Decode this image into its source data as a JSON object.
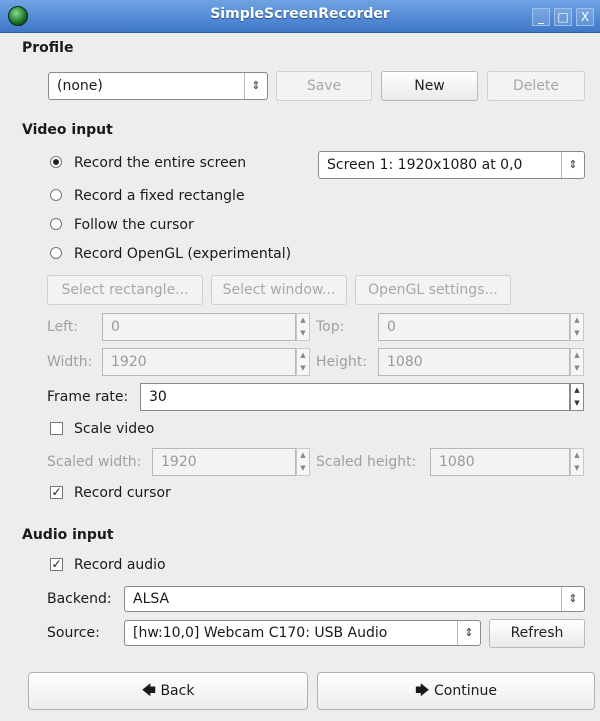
{
  "window": {
    "title": "SimpleScreenRecorder",
    "controls": {
      "minimize": "_",
      "maximize": "□",
      "close": "X"
    }
  },
  "profile": {
    "heading": "Profile",
    "selected": "(none)",
    "buttons": {
      "save": "Save",
      "new": "New",
      "delete": "Delete"
    }
  },
  "video": {
    "heading": "Video input",
    "options": {
      "entire": "Record the entire screen",
      "fixed": "Record a fixed rectangle",
      "follow": "Follow the cursor",
      "opengl": "Record OpenGL (experimental)"
    },
    "screen_select": "Screen 1: 1920x1080 at 0,0",
    "buttons": {
      "select_rect": "Select rectangle...",
      "select_window": "Select window...",
      "opengl_settings": "OpenGL settings..."
    },
    "left_label": "Left:",
    "left_value": "0",
    "top_label": "Top:",
    "top_value": "0",
    "width_label": "Width:",
    "width_value": "1920",
    "height_label": "Height:",
    "height_value": "1080",
    "framerate_label": "Frame rate:",
    "framerate_value": "30",
    "scale_label": "Scale video",
    "scaled_width_label": "Scaled width:",
    "scaled_width_value": "1920",
    "scaled_height_label": "Scaled height:",
    "scaled_height_value": "1080",
    "cursor_label": "Record cursor"
  },
  "audio": {
    "heading": "Audio input",
    "record_label": "Record audio",
    "backend_label": "Backend:",
    "backend_value": "ALSA",
    "source_label": "Source:",
    "source_value": "[hw:10,0] Webcam C170: USB Audio",
    "refresh": "Refresh"
  },
  "footer": {
    "back": "Back",
    "continue": "Continue"
  },
  "glyphs": {
    "combo_arrow": "⇕",
    "check": "✓",
    "back_arrow": "🡄",
    "continue_arrow": "🡆",
    "spin_up": "▲",
    "spin_down": "▼"
  }
}
